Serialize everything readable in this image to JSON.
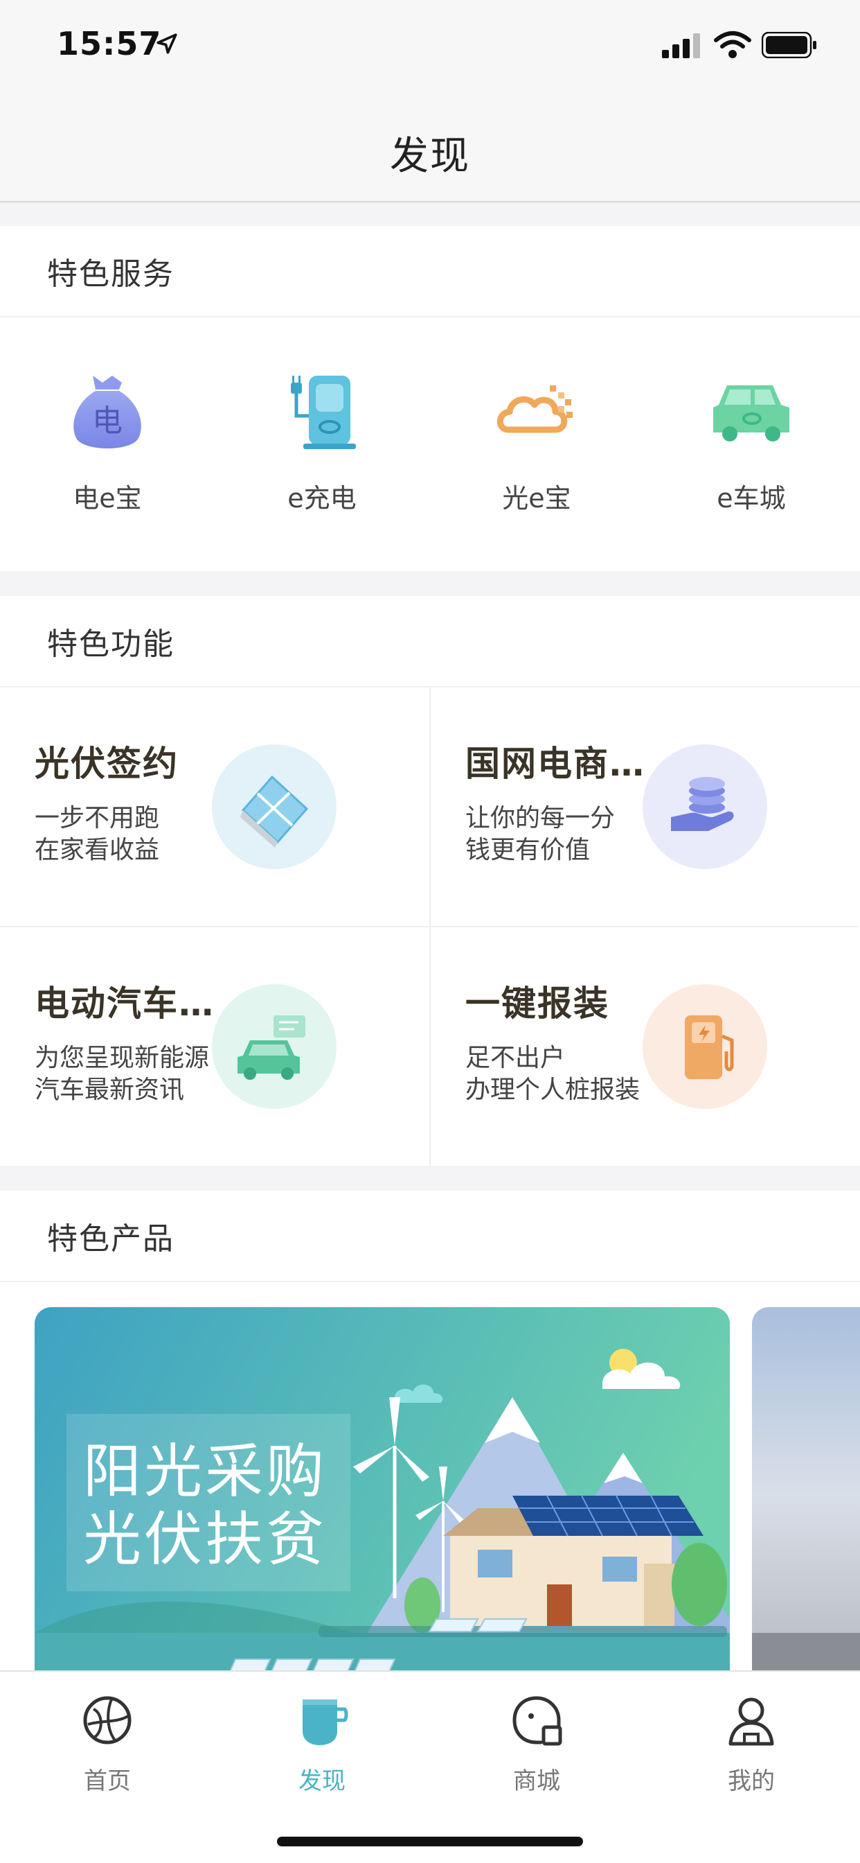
{
  "status_bar": {
    "time": "15:57",
    "icons": [
      "location-arrow-icon",
      "cellular-signal-icon",
      "wifi-icon",
      "battery-icon"
    ]
  },
  "nav": {
    "title": "发现"
  },
  "services": {
    "title": "特色服务",
    "items": [
      {
        "label": "电e宝",
        "icon": "money-bag-icon"
      },
      {
        "label": "e充电",
        "icon": "charging-station-icon"
      },
      {
        "label": "光e宝",
        "icon": "solar-cloud-icon"
      },
      {
        "label": "e车城",
        "icon": "car-icon"
      }
    ]
  },
  "functions": {
    "title": "特色功能",
    "items": [
      {
        "title": "光伏签约",
        "line1": "一步不用跑",
        "line2": "在家看收益",
        "icon": "solar-panel-icon",
        "bg": "#e3f1f8"
      },
      {
        "title": "国网电商…",
        "line1": "让你的每一分",
        "line2": "钱更有价值",
        "icon": "coins-hand-icon",
        "bg": "#e9ebfa"
      },
      {
        "title": "电动汽车…",
        "line1": "为您呈现新能源",
        "line2": "汽车最新资讯",
        "icon": "ev-news-icon",
        "bg": "#e2f5ef"
      },
      {
        "title": "一键报装",
        "line1": "足不出户",
        "line2": "办理个人桩报装",
        "icon": "charger-pump-icon",
        "bg": "#fcebe0"
      }
    ]
  },
  "products": {
    "title": "特色产品",
    "banner": {
      "line1": "阳光采购",
      "line2": "光伏扶贫"
    }
  },
  "tabs": [
    {
      "label": "首页",
      "icon": "globe-icon",
      "active": false
    },
    {
      "label": "发现",
      "icon": "cup-icon",
      "active": true
    },
    {
      "label": "商城",
      "icon": "shop-bag-icon",
      "active": false
    },
    {
      "label": "我的",
      "icon": "user-icon",
      "active": false
    }
  ],
  "colors": {
    "accent": "#4bb3c8",
    "title_text": "#3a3328"
  }
}
